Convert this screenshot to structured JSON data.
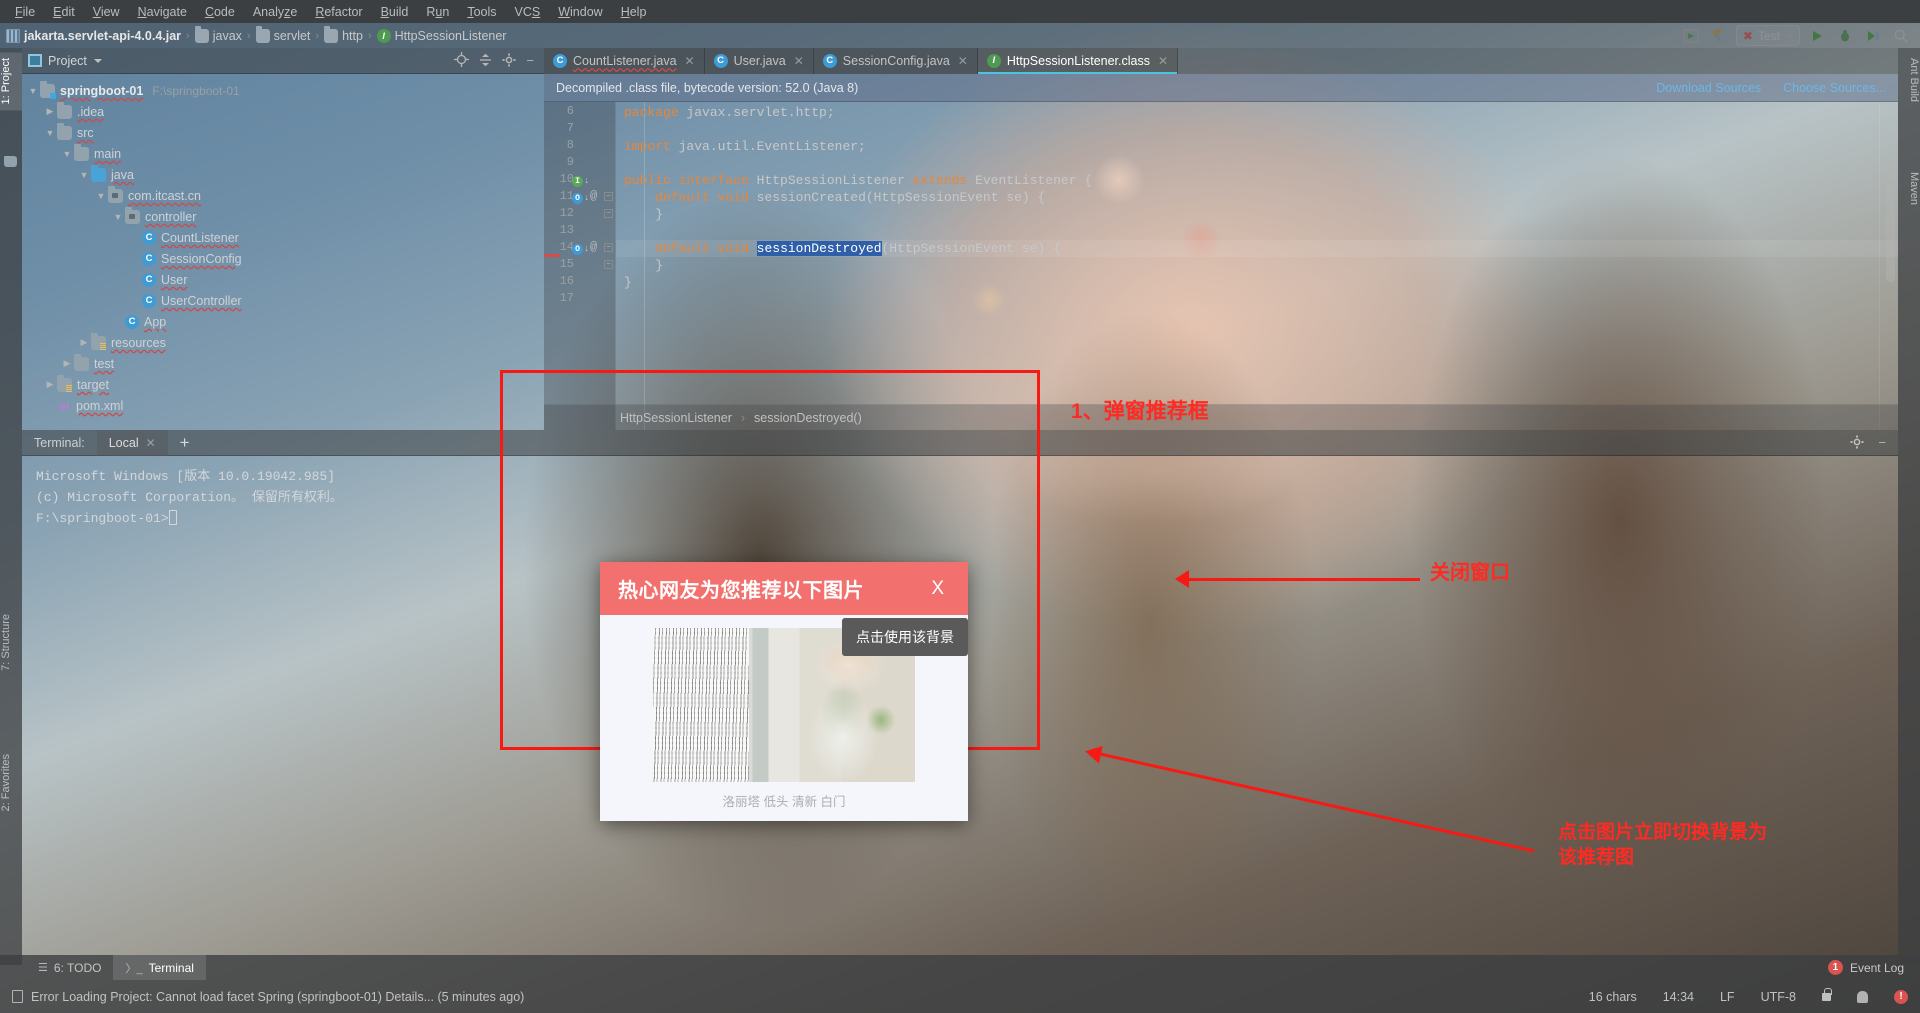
{
  "menu": {
    "items": [
      "File",
      "Edit",
      "View",
      "Navigate",
      "Code",
      "Analyze",
      "Refactor",
      "Build",
      "Run",
      "Tools",
      "VCS",
      "Window",
      "Help"
    ]
  },
  "navbar": {
    "crumbs": [
      {
        "label": "jakarta.servlet-api-4.0.4.jar",
        "icon": "jar-icon",
        "bold": true
      },
      {
        "label": "javax",
        "icon": "folder-icon",
        "bold": false
      },
      {
        "label": "servlet",
        "icon": "folder-icon",
        "bold": false
      },
      {
        "label": "http",
        "icon": "folder-icon",
        "bold": false
      },
      {
        "label": "HttpSessionListener",
        "icon": "interface-icon",
        "bold": false
      }
    ],
    "separator": "›"
  },
  "toolbar": {
    "run_config_name": "Test",
    "run_config_icon": "x-red-icon",
    "buttons": [
      "project-structure-icon",
      "build-hammer-icon",
      "run-icon",
      "debug-icon",
      "coverage-icon",
      "search-everywhere-icon"
    ]
  },
  "left_strip": {
    "project_tab": "1: Project",
    "structure_tab": "7: Structure",
    "favorites_tab": "2: Favorites"
  },
  "right_strip": {
    "ant_build_tab": "Ant Build",
    "maven_tab": "Maven"
  },
  "project_panel": {
    "title": "Project",
    "actions": [
      "locate-icon",
      "collapse-all-icon",
      "settings-gear-icon",
      "hide-icon"
    ],
    "tree": [
      {
        "indent": 0,
        "twisty": "▼",
        "icon": "module-icon",
        "label": "springboot-01",
        "bold": true,
        "path": "F:\\springboot-01"
      },
      {
        "indent": 1,
        "twisty": "▶",
        "icon": "folder-icon",
        "label": ".idea",
        "bold": false,
        "path": ""
      },
      {
        "indent": 1,
        "twisty": "▼",
        "icon": "folder-icon",
        "label": "src",
        "bold": false,
        "path": ""
      },
      {
        "indent": 2,
        "twisty": "▼",
        "icon": "folder-icon",
        "label": "main",
        "bold": false,
        "path": ""
      },
      {
        "indent": 3,
        "twisty": "▼",
        "icon": "source-folder-icon",
        "label": "java",
        "bold": false,
        "path": ""
      },
      {
        "indent": 4,
        "twisty": "▼",
        "icon": "package-icon",
        "label": "com.itcast.cn",
        "bold": false,
        "path": ""
      },
      {
        "indent": 5,
        "twisty": "▼",
        "icon": "package-icon",
        "label": "controller",
        "bold": false,
        "path": ""
      },
      {
        "indent": 6,
        "twisty": "",
        "icon": "class-icon",
        "label": "CountListener",
        "bold": false,
        "path": ""
      },
      {
        "indent": 6,
        "twisty": "",
        "icon": "class-icon",
        "label": "SessionConfig",
        "bold": false,
        "path": ""
      },
      {
        "indent": 6,
        "twisty": "",
        "icon": "class-icon",
        "label": "User",
        "bold": false,
        "path": ""
      },
      {
        "indent": 6,
        "twisty": "",
        "icon": "class-icon",
        "label": "UserController",
        "bold": false,
        "path": ""
      },
      {
        "indent": 5,
        "twisty": "",
        "icon": "class-icon",
        "label": "App",
        "bold": false,
        "path": ""
      },
      {
        "indent": 3,
        "twisty": "▶",
        "icon": "resource-folder-icon",
        "label": "resources",
        "bold": false,
        "path": ""
      },
      {
        "indent": 2,
        "twisty": "▶",
        "icon": "folder-icon",
        "label": "test",
        "bold": false,
        "path": ""
      },
      {
        "indent": 1,
        "twisty": "▶",
        "icon": "target-folder-icon",
        "label": "target",
        "bold": false,
        "path": ""
      },
      {
        "indent": 1,
        "twisty": "",
        "icon": "maven-icon",
        "label": "pom.xml",
        "bold": false,
        "path": ""
      }
    ]
  },
  "editor": {
    "tabs": [
      {
        "label": "CountListener.java",
        "icon": "class-icon",
        "active": false
      },
      {
        "label": "User.java",
        "icon": "class-icon",
        "active": false
      },
      {
        "label": "SessionConfig.java",
        "icon": "class-icon",
        "active": false
      },
      {
        "label": "HttpSessionListener.class",
        "icon": "interface-icon",
        "active": true
      }
    ],
    "notification": "Decompiled .class file, bytecode version: 52.0 (Java 8)",
    "notification_links": [
      "Download Sources",
      "Choose Sources..."
    ],
    "lines": [
      {
        "num": "6",
        "text": "package javax.servlet.http;",
        "marker": "",
        "at": false,
        "fold": false,
        "hl": false
      },
      {
        "num": "7",
        "text": "",
        "marker": "",
        "at": false,
        "fold": false,
        "hl": false
      },
      {
        "num": "8",
        "text": "import java.util.EventListener;",
        "marker": "",
        "at": false,
        "fold": false,
        "hl": false
      },
      {
        "num": "9",
        "text": "",
        "marker": "",
        "at": false,
        "fold": false,
        "hl": false
      },
      {
        "num": "10",
        "text": "public interface HttpSessionListener extends EventListener {",
        "marker": "impl-green",
        "at": false,
        "fold": false,
        "hl": false
      },
      {
        "num": "11",
        "text": "    default void sessionCreated(HttpSessionEvent se) {",
        "marker": "impl-blue",
        "at": true,
        "fold": true,
        "hl": false
      },
      {
        "num": "12",
        "text": "    }",
        "marker": "",
        "at": false,
        "fold": true,
        "hl": false
      },
      {
        "num": "13",
        "text": "",
        "marker": "",
        "at": false,
        "fold": false,
        "hl": false
      },
      {
        "num": "14",
        "text": "    default void sessionDestroyed(HttpSessionEvent se) {",
        "marker": "impl-blue",
        "at": true,
        "fold": true,
        "hl": true
      },
      {
        "num": "15",
        "text": "    }",
        "marker": "",
        "at": false,
        "fold": true,
        "hl": false
      },
      {
        "num": "16",
        "text": "}",
        "marker": "",
        "at": false,
        "fold": false,
        "hl": false
      },
      {
        "num": "17",
        "text": "",
        "marker": "",
        "at": false,
        "fold": false,
        "hl": false
      }
    ],
    "selected_token": "sessionDestroyed",
    "breadcrumb": [
      "HttpSessionListener",
      "sessionDestroyed()"
    ],
    "breadcrumb_separator": "›"
  },
  "terminal": {
    "label": "Terminal:",
    "tab_name": "Local",
    "add_label": "+",
    "actions": [
      "settings-gear-icon",
      "hide-icon"
    ],
    "lines": [
      "Microsoft Windows [版本 10.0.19042.985]",
      "(c) Microsoft Corporation。 保留所有权利。",
      "",
      "F:\\springboot-01>"
    ]
  },
  "bottom_tabs": {
    "items": [
      {
        "label": "6: TODO",
        "icon": "todo-icon",
        "selected": false
      },
      {
        "label": "Terminal",
        "icon": "terminal-icon",
        "selected": true
      }
    ],
    "event_log": {
      "label": "Event Log",
      "count": "1"
    }
  },
  "statusbar": {
    "message": "Error Loading Project: Cannot load facet Spring (springboot-01) Details... (5 minutes ago)",
    "chars": "16 chars",
    "time": "14:34",
    "line_sep": "LF",
    "encoding": "UTF-8",
    "icons": [
      "lock-icon",
      "person-icon",
      "warning-icon"
    ]
  },
  "popup": {
    "title": "热心网友为您推荐以下图片",
    "close_label": "X",
    "tooltip": "点击使用该背景",
    "caption": "洛丽塔 低头 清新 白门",
    "header_color": "#f2716e",
    "body_color": "#f4f6fb"
  },
  "annotations": {
    "color": "#ff2a22",
    "items": [
      {
        "text": "1、弹窗推荐框"
      },
      {
        "text": "关闭窗口"
      },
      {
        "text": "点击图片立即切换背景为\n该推荐图"
      }
    ]
  }
}
